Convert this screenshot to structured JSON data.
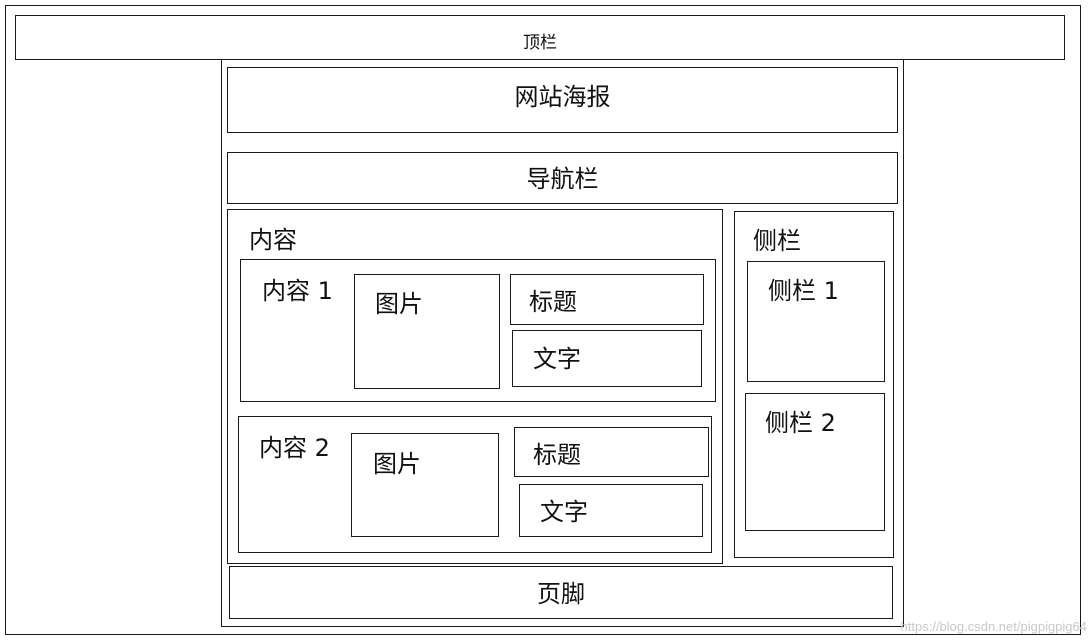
{
  "diagram": {
    "top_bar": "顶栏",
    "banner": "网站海报",
    "nav": "导航栏",
    "content": {
      "label": "内容",
      "items": [
        {
          "label": "内容 1",
          "image": "图片",
          "title": "标题",
          "text": "文字"
        },
        {
          "label": "内容 2",
          "image": "图片",
          "title": "标题",
          "text": "文字"
        }
      ]
    },
    "sidebar": {
      "label": "侧栏",
      "items": [
        {
          "label": "侧栏 1"
        },
        {
          "label": "侧栏 2"
        }
      ]
    },
    "footer": "页脚"
  },
  "watermark": "https://blog.csdn.net/pigpigpig64"
}
